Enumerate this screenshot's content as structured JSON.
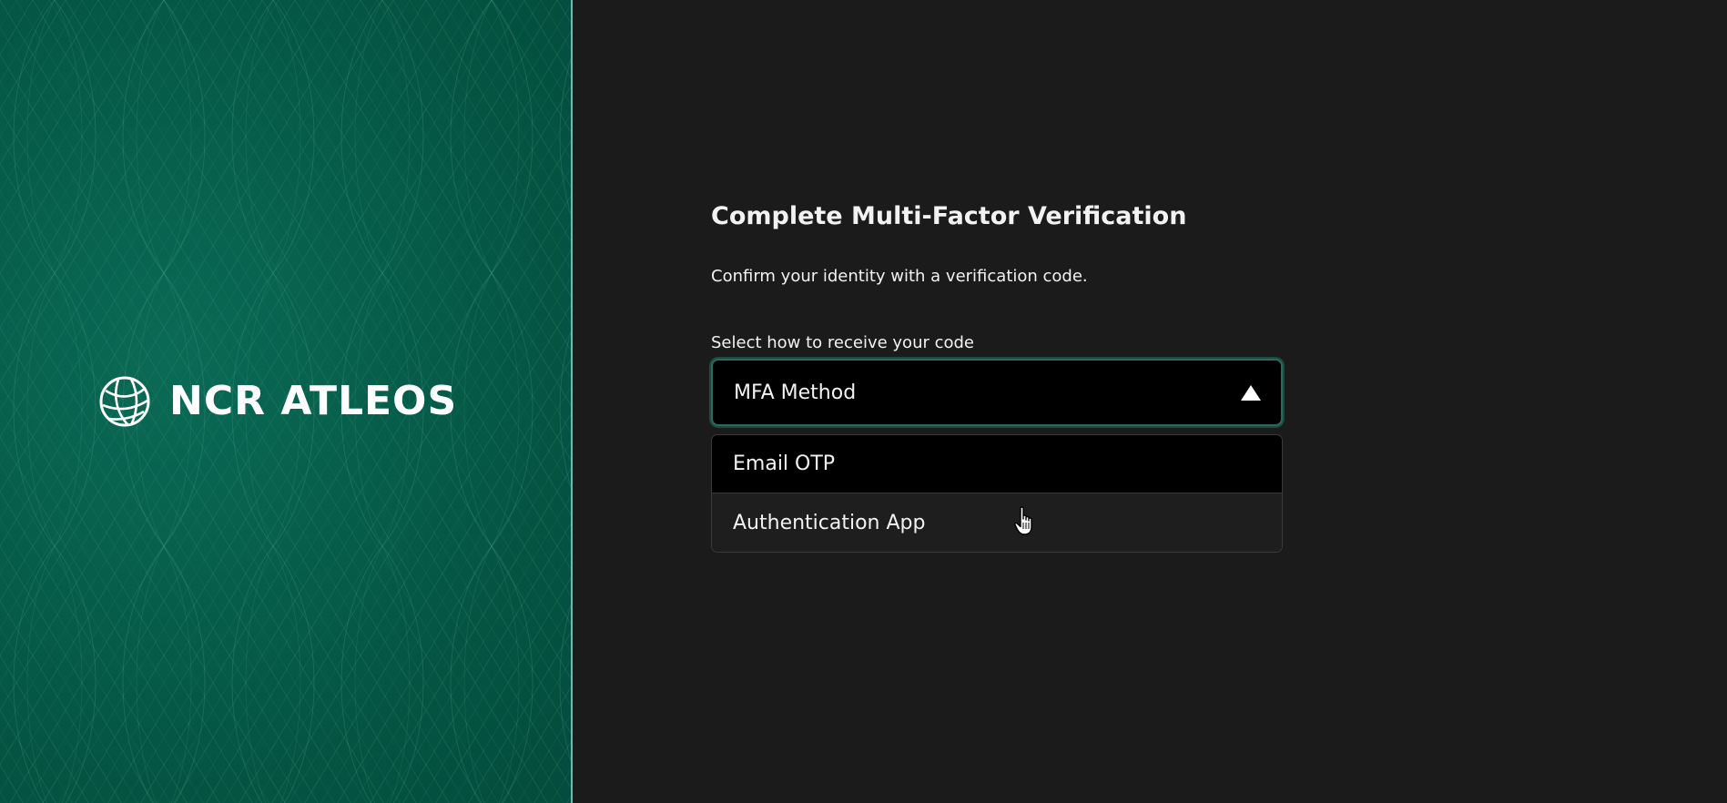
{
  "brand": {
    "name": "NCR ATLEOS",
    "logo_icon": "globe-icon",
    "panel_color": "#055846"
  },
  "verification": {
    "title": "Complete Multi-Factor Verification",
    "subtitle": "Confirm your identity with a verification code.",
    "field_label": "Select how to receive your code",
    "select_value": "MFA Method",
    "select_icon": "caret-up-icon",
    "options": [
      {
        "label": "Email OTP",
        "highlighted": true
      },
      {
        "label": "Authentication App",
        "hovered": true
      }
    ]
  },
  "colors": {
    "background": "#1b1b1b",
    "select_border": "#2a6a5d",
    "text": "#f2f2f2"
  },
  "cursor": "pointer-hand-icon"
}
